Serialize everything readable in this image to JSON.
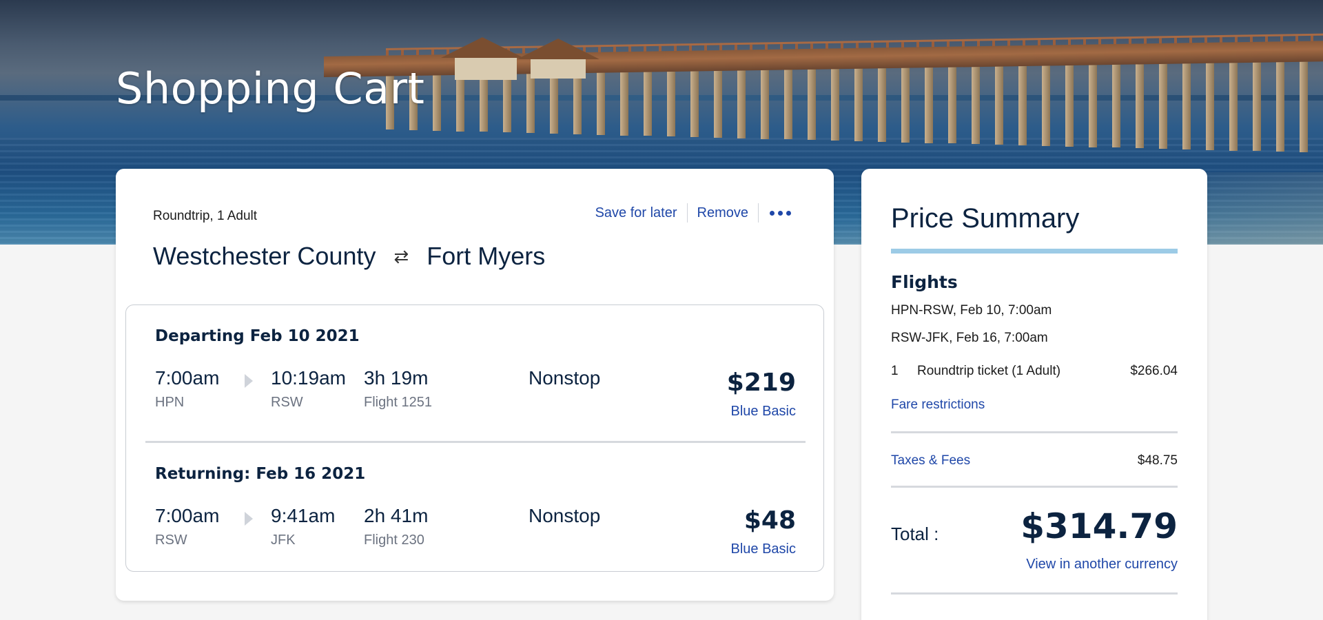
{
  "hero": {
    "title": "Shopping Cart"
  },
  "trip": {
    "meta": "Roundtrip, 1 Adult",
    "actions": {
      "save_label": "Save for later",
      "remove_label": "Remove",
      "more_icon": "more-horizontal-icon"
    },
    "origin": "Westchester County",
    "destination": "Fort Myers",
    "swap_glyph": "⇄",
    "segments": [
      {
        "title": "Departing Feb 10 2021",
        "depart_time": "7:00am",
        "depart_code": "HPN",
        "arrive_time": "10:19am",
        "arrive_code": "RSW",
        "duration": "3h 19m",
        "flight": "Flight 1251",
        "stops": "Nonstop",
        "price": "$219",
        "fare": "Blue Basic"
      },
      {
        "title": "Returning: Feb 16 2021",
        "depart_time": "7:00am",
        "depart_code": "RSW",
        "arrive_time": "9:41am",
        "arrive_code": "JFK",
        "duration": "2h 41m",
        "flight": "Flight 230",
        "stops": "Nonstop",
        "price": "$48",
        "fare": "Blue Basic"
      }
    ]
  },
  "summary": {
    "title": "Price Summary",
    "flights_heading": "Flights",
    "legs": [
      "HPN-RSW, Feb 10, 7:00am",
      "RSW-JFK, Feb 16, 7:00am"
    ],
    "ticket": {
      "qty": "1",
      "desc": "Roundtrip ticket (1 Adult)",
      "amount": "$266.04"
    },
    "fare_restrictions": "Fare restrictions",
    "taxes_label": "Taxes & Fees",
    "taxes_amount": "$48.75",
    "total_label": "Total :",
    "total_amount": "$314.79",
    "currency_link": "View in another currency"
  },
  "colors": {
    "navy": "#0c2340",
    "link": "#1f47a8",
    "accent_bar": "#9ccbe6"
  }
}
